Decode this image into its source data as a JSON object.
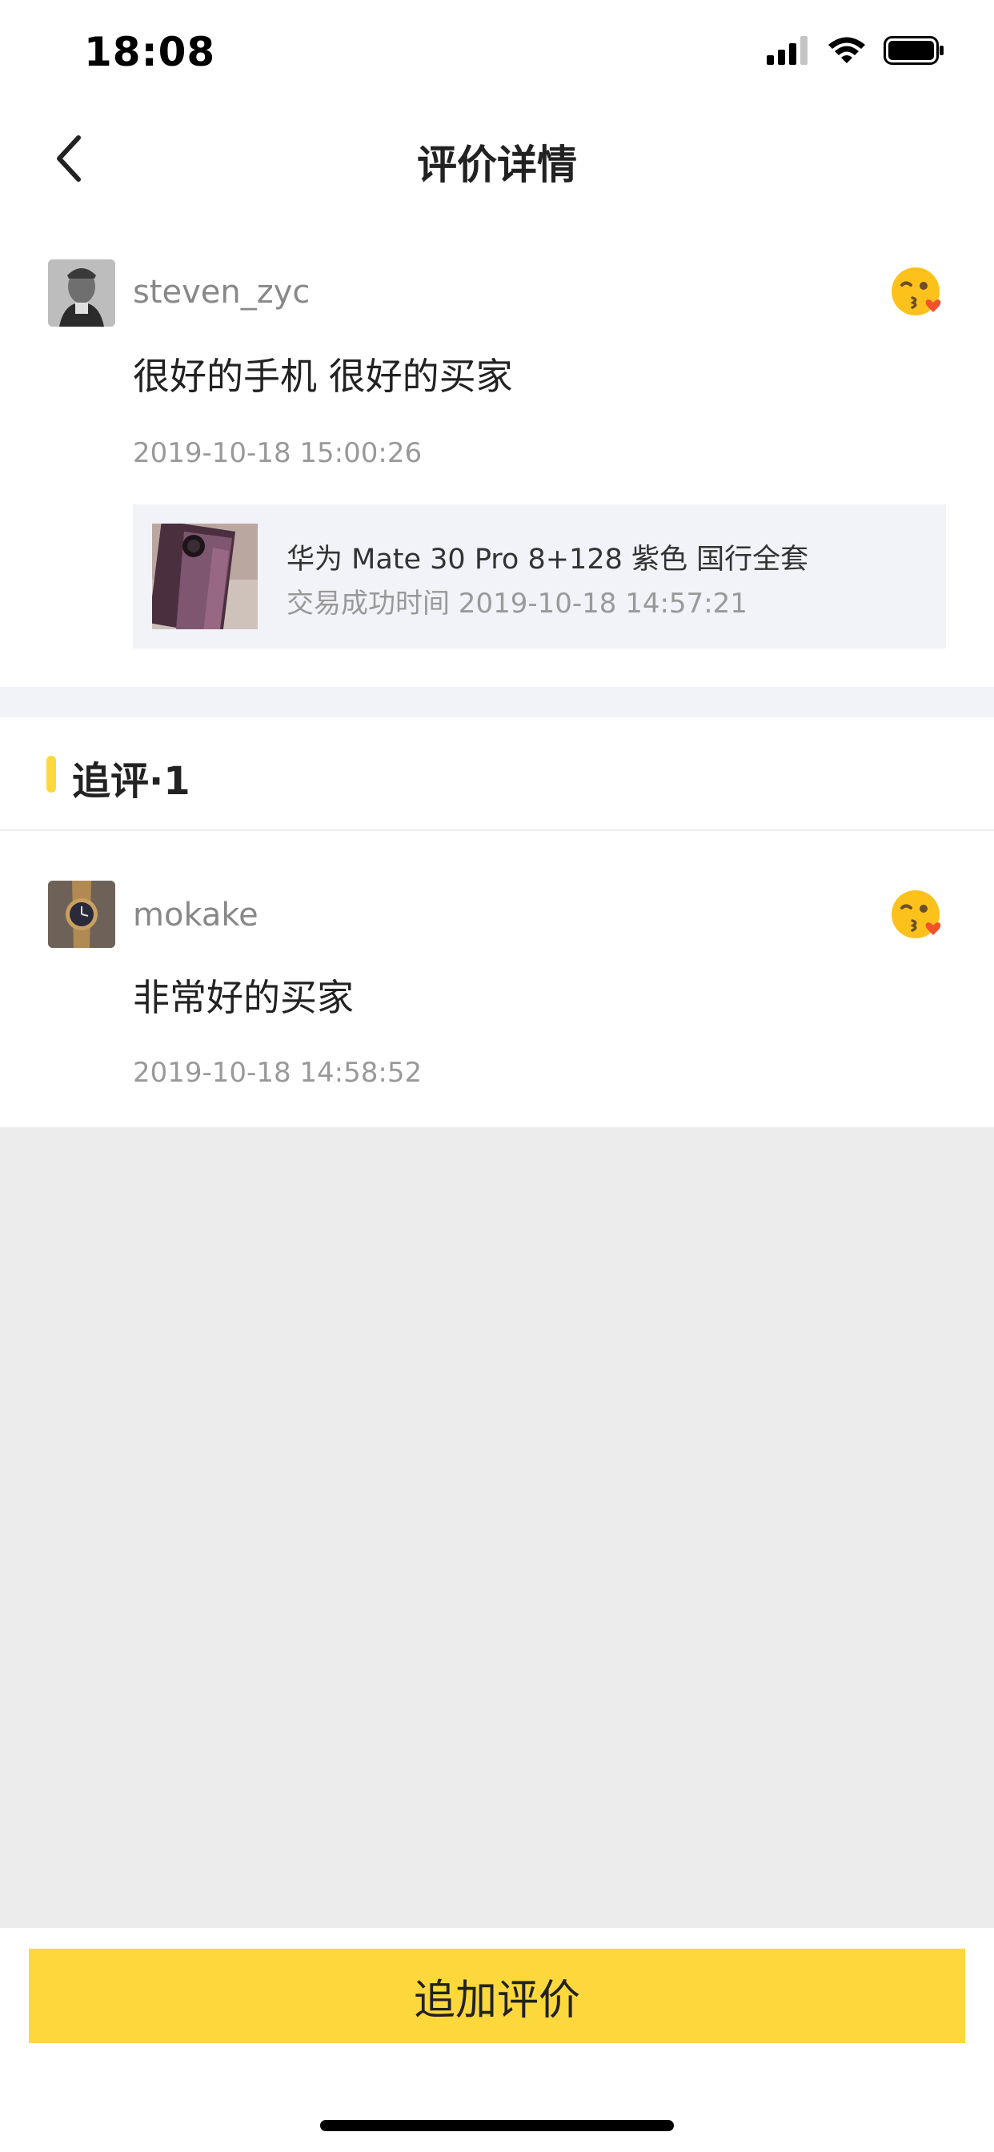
{
  "status_bar": {
    "time": "18:08",
    "icons": [
      "cellular-signal-icon",
      "wifi-icon",
      "battery-icon"
    ]
  },
  "nav": {
    "title": "评价详情",
    "back_icon": "chevron-left-icon"
  },
  "main_review": {
    "username": "steven_zyc",
    "text": "很好的手机 很好的买家",
    "time": "2019-10-18 15:00:26",
    "emoji_icon": "kissing-heart-emoji-icon",
    "product": {
      "name": "华为 Mate 30 Pro 8+128 紫色 国行全套",
      "deal_time": "交易成功时间 2019-10-18 14:57:21"
    }
  },
  "followups": {
    "title": "追评·1",
    "items": [
      {
        "username": "mokake",
        "text": "非常好的买家",
        "time": "2019-10-18 14:58:52",
        "emoji_icon": "kissing-heart-emoji-icon"
      }
    ]
  },
  "footer": {
    "add_review_label": "追加评价"
  },
  "colors": {
    "accent": "#fdd83c",
    "page_bg": "#ececed",
    "card_bg": "#f2f3f8"
  }
}
